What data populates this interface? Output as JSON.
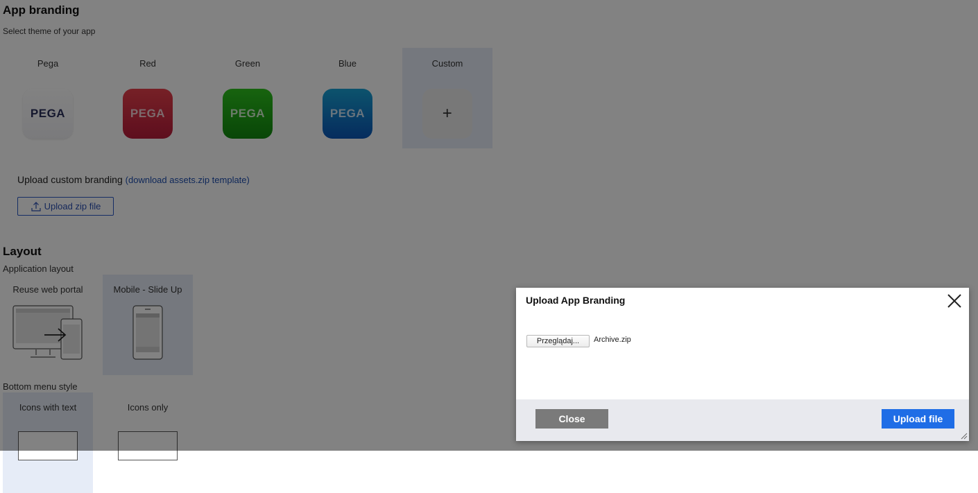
{
  "branding": {
    "title": "App branding",
    "subtitle": "Select theme of your app",
    "themes": [
      {
        "label": "Pega",
        "tile_text": "PEGA"
      },
      {
        "label": "Red",
        "tile_text": "PEGA"
      },
      {
        "label": "Green",
        "tile_text": "PEGA"
      },
      {
        "label": "Blue",
        "tile_text": "PEGA"
      },
      {
        "label": "Custom",
        "tile_text": "+"
      }
    ],
    "upload_text": "Upload custom branding ",
    "template_link": "(download assets.zip template)",
    "upload_button": "Upload zip file",
    "colors": {
      "red": "#c8283f",
      "green": "#1ea317",
      "blue": "#1172c4",
      "selected_bg": "#e6ecf7"
    }
  },
  "layout": {
    "title": "Layout",
    "app_layout_label": "Application layout",
    "options": [
      {
        "label": "Reuse web portal"
      },
      {
        "label": "Mobile - Slide Up"
      }
    ],
    "bottom_menu_label": "Bottom menu style",
    "menu_options": [
      {
        "label": "Icons with text"
      },
      {
        "label": "Icons only"
      }
    ]
  },
  "modal": {
    "title": "Upload App Branding",
    "browse_button": "Przeglądaj...",
    "file_name": "Archive.zip",
    "close_button": "Close",
    "upload_button": "Upload file",
    "colors": {
      "upload": "#1f6de6",
      "close": "#7a7a7a"
    }
  }
}
